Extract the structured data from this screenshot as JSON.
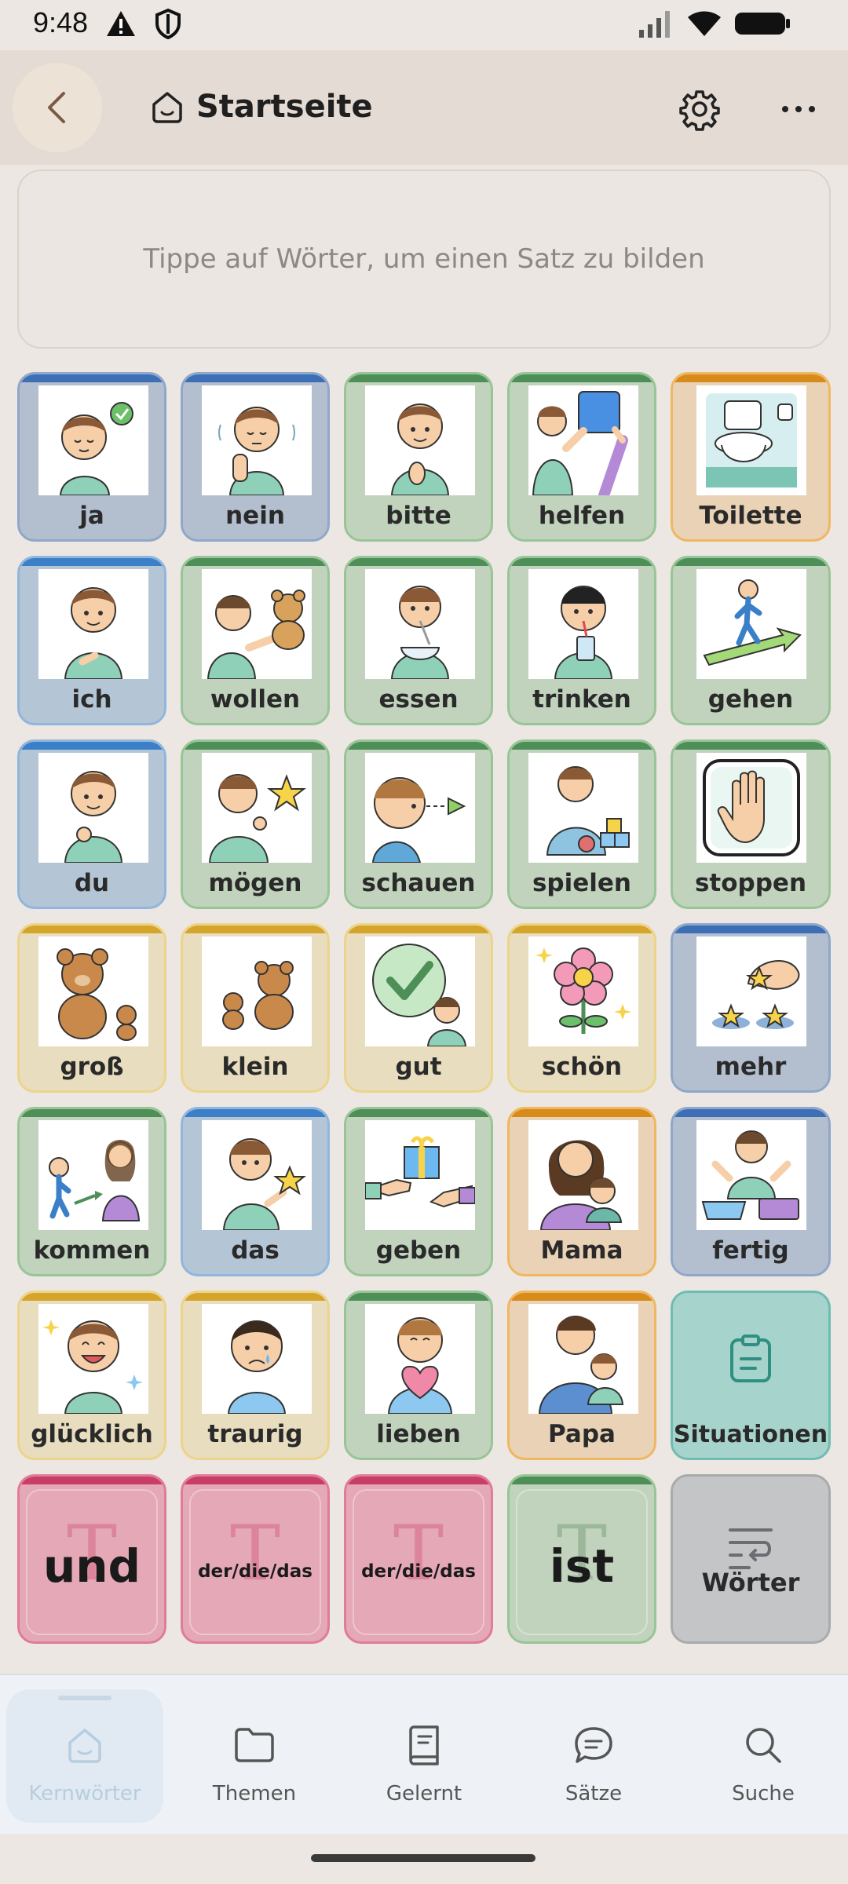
{
  "status_bar": {
    "time": "9:48"
  },
  "header": {
    "title": "Startseite"
  },
  "sentence_box": {
    "placeholder": "Tippe auf Wörter, um einen Satz zu bilden"
  },
  "tiles": {
    "ja": "ja",
    "nein": "nein",
    "bitte": "bitte",
    "helfen": "helfen",
    "toilette": "Toilette",
    "ich": "ich",
    "wollen": "wollen",
    "essen": "essen",
    "trinken": "trinken",
    "gehen": "gehen",
    "du": "du",
    "moegen": "mögen",
    "schauen": "schauen",
    "spielen": "spielen",
    "stoppen": "stoppen",
    "gross": "groß",
    "klein": "klein",
    "gut": "gut",
    "schoen": "schön",
    "mehr": "mehr",
    "kommen": "kommen",
    "das": "das",
    "geben": "geben",
    "mama": "Mama",
    "fertig": "fertig",
    "gluecklich": "glücklich",
    "traurig": "traurig",
    "lieben": "lieben",
    "papa": "Papa",
    "situationen": "Situationen",
    "und": "und",
    "der_die_das_1": "der/die/das",
    "der_die_das_2": "der/die/das",
    "ist": "ist",
    "woerter": "Wörter"
  },
  "bottom_nav": {
    "kernwoerter": "Kernwörter",
    "themen": "Themen",
    "gelernt": "Gelernt",
    "saetze": "Sätze",
    "suche": "Suche"
  },
  "colors": {
    "header_bg": "#e3dbd4",
    "page_bg": "#ece7e2",
    "blue": "#3d6fb6",
    "green": "#4e8f58",
    "orange": "#d68b1b",
    "yellow": "#d4a42b",
    "pink": "#c93e66",
    "teal": "#6fbdb2"
  }
}
